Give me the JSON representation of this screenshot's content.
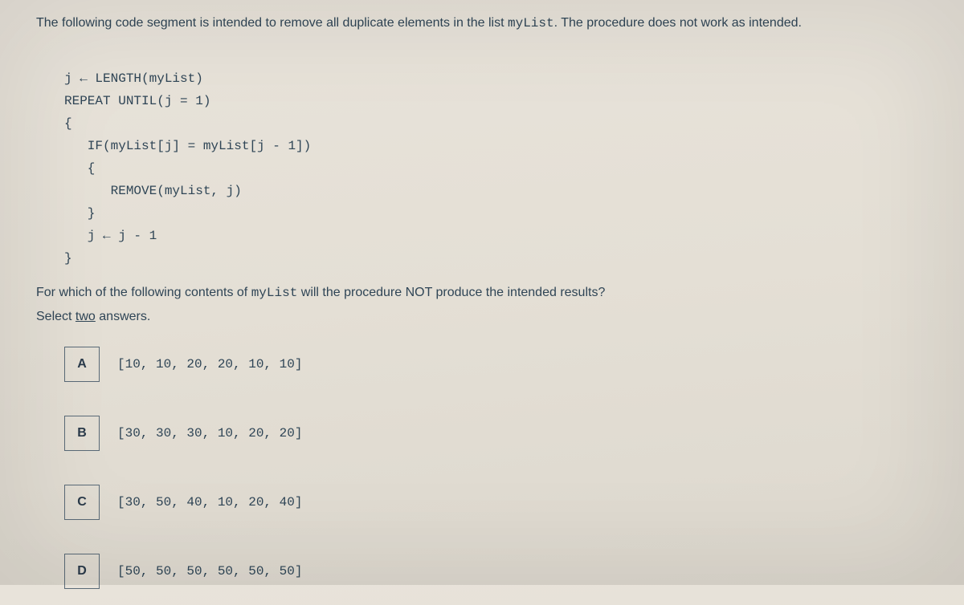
{
  "intro": {
    "pre": "The following code segment is intended to remove all duplicate elements in the list ",
    "code": "myList",
    "post": ".  The procedure does not work as intended."
  },
  "code_lines": [
    "j ← LENGTH(myList)",
    "REPEAT UNTIL(j = 1)",
    "{",
    "   IF(myList[j] = myList[j - 1])",
    "   {",
    "      REMOVE(myList, j)",
    "   }",
    "   j ← j - 1",
    "}"
  ],
  "follow": {
    "pre": "For which of the following contents of ",
    "code": "myList",
    "post": " will the procedure NOT produce the intended results?"
  },
  "select_prefix": "Select ",
  "select_underlined": "two",
  "select_suffix": " answers.",
  "options": [
    {
      "letter": "A",
      "text": "[10, 10, 20, 20, 10, 10]"
    },
    {
      "letter": "B",
      "text": "[30, 30, 30, 10, 20, 20]"
    },
    {
      "letter": "C",
      "text": "[30, 50, 40, 10, 20, 40]"
    },
    {
      "letter": "D",
      "text": "[50, 50, 50, 50, 50, 50]"
    }
  ]
}
